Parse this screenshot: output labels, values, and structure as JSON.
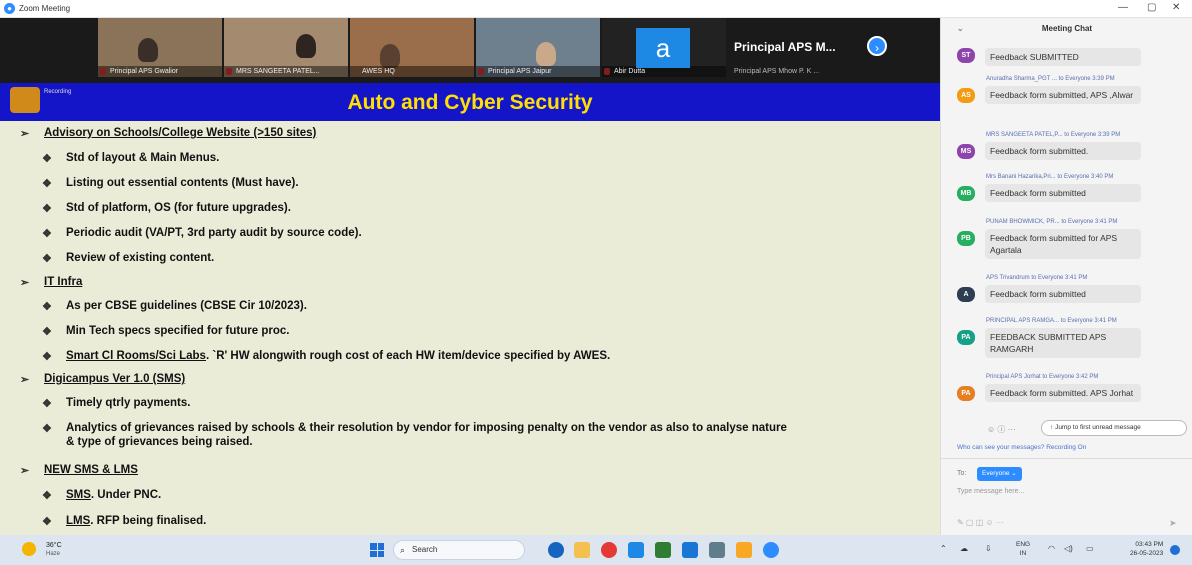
{
  "window": {
    "title": "Zoom Meeting",
    "app_icon": "zoom-icon",
    "controls": [
      "—",
      "▢",
      "✕"
    ]
  },
  "participants": [
    {
      "name": "Principal APS Gwalior"
    },
    {
      "name": "MRS SANGEETA PATEL..."
    },
    {
      "name": "AWES HQ"
    },
    {
      "name": "Principal APS Jaipur"
    },
    {
      "name": "Abir Dutta",
      "avatar_letter": "a"
    }
  ],
  "active_speaker": {
    "name": "Principal APS M...",
    "subtitle": "Principal APS Mhow P. K ..."
  },
  "slide": {
    "recording_label": "Recording",
    "title": "Auto and Cyber Security",
    "sections": [
      {
        "heading": "Advisory on Schools/College Website (>150 sites)",
        "items": [
          "Std of layout & Main Menus.",
          "Listing out essential contents (Must have).",
          "Std of platform, OS (for future upgrades).",
          "Periodic audit (VA/PT, 3rd party audit by source code).",
          "Review of existing content."
        ]
      },
      {
        "heading": "IT Infra",
        "items": [
          "As per CBSE guidelines  (CBSE Cir 10/2023).",
          "Min Tech specs specified for future proc.",
          "Smart Cl Rooms/Sci Labs",
          ". `R' HW alongwith rough cost of each HW item/device specified by AWES."
        ]
      },
      {
        "heading": "Digicampus Ver 1.0 (SMS)",
        "items": [
          "Timely qtrly payments.",
          "Analytics of grievances raised by schools & their resolution by vendor for imposing penalty on the vendor as also to analyse nature",
          "& type of grievances being raised."
        ]
      },
      {
        "heading": "NEW SMS & LMS",
        "items": [
          "SMS",
          ". Under PNC.",
          "LMS",
          ". RFP being finalised."
        ]
      }
    ]
  },
  "chat": {
    "title": "Meeting Chat",
    "messages": [
      {
        "initials": "ST",
        "color": "#8e44ad",
        "sender": "",
        "text": "Feedback SUBMITTED"
      },
      {
        "initials": "AS",
        "color": "#f39c12",
        "sender": "Anuradha Sharma_PGT ...  to Everyone 3:39 PM",
        "text": "Feedback form submitted, APS ,Alwar"
      },
      {
        "initials": "MS",
        "color": "#8e44ad",
        "sender": "MRS SANGEETA PATEL,P...  to Everyone 3:39 PM",
        "text": "Feedback form submitted."
      },
      {
        "initials": "MB",
        "color": "#27ae60",
        "sender": "Mrs Banani Hazarika,Pri...  to Everyone 3:40 PM",
        "text": "Feedback form submitted"
      },
      {
        "initials": "PB",
        "color": "#27ae60",
        "sender": "PUNAM BHOWMICK, PR...  to Everyone 3:41 PM",
        "text": "Feedback form submitted for APS Agartala"
      },
      {
        "initials": "A",
        "color": "#2c3e50",
        "sender": "APS Trivandrum to Everyone 3:41 PM",
        "text": "Feedback form submitted"
      },
      {
        "initials": "PA",
        "color": "#16a085",
        "sender": "PRINCIPAL APS RAMGA...  to Everyone 3:41 PM",
        "text": "FEEDBACK SUBMITTED APS RAMGARH"
      },
      {
        "initials": "PA",
        "color": "#e67e22",
        "sender": "Principal APS Jorhat to Everyone 3:42 PM",
        "text": "Feedback form submitted. APS Jorhat"
      }
    ],
    "jump_label": "Jump to first unread message",
    "who_can_see": "Who can see your messages? Recording On",
    "to_label": "To:",
    "recipient": "Everyone ⌄",
    "placeholder": "Type message here..."
  },
  "taskbar": {
    "weather_temp": "36°C",
    "weather_desc": "Haze",
    "search_label": "Search",
    "lang_top": "ENG",
    "lang_bottom": "IN",
    "time": "03:43 PM",
    "date": "26-05-2023"
  }
}
